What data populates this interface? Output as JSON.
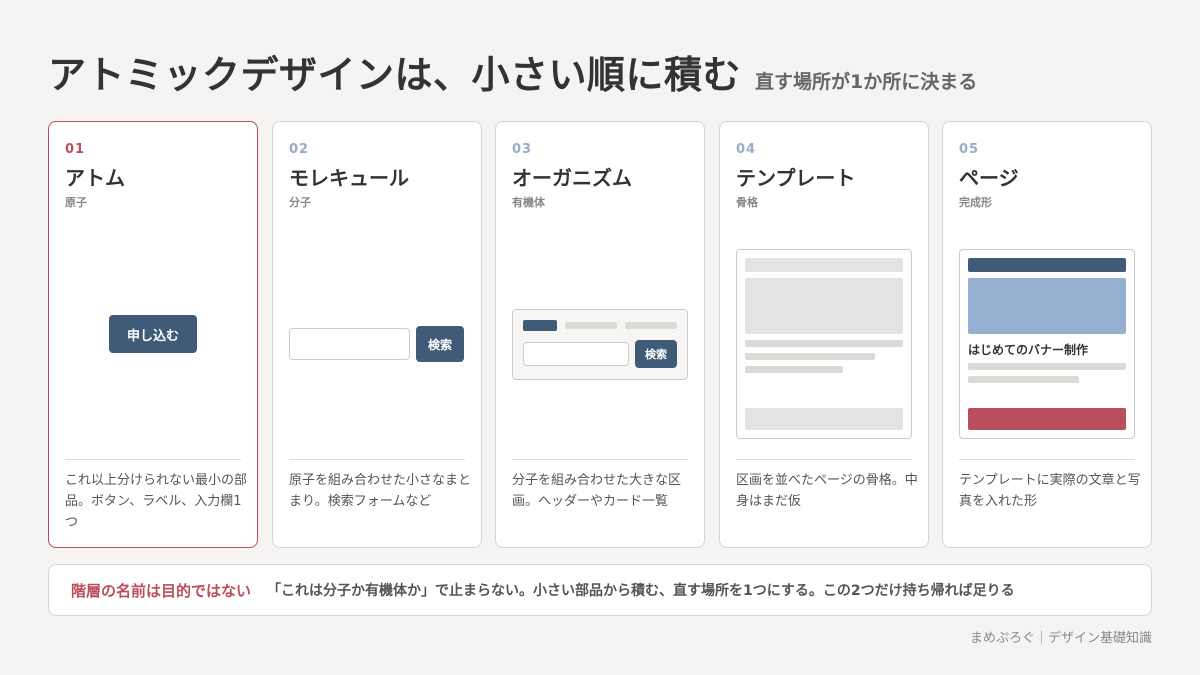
{
  "header": {
    "title": "アトミックデザインは、小さい順に積む",
    "subtitle": "直す場所が1か所に決まる"
  },
  "cards": [
    {
      "num": "01",
      "name": "アトム",
      "sub": "原子",
      "desc": "これ以上分けられない最小の部品。ボタン、ラベル、入力欄1つ",
      "illustration": {
        "button_label": "申し込む"
      }
    },
    {
      "num": "02",
      "name": "モレキュール",
      "sub": "分子",
      "desc": "原子を組み合わせた小さなまとまり。検索フォームなど",
      "illustration": {
        "button_label": "検索"
      }
    },
    {
      "num": "03",
      "name": "オーガニズム",
      "sub": "有機体",
      "desc": "分子を組み合わせた大きな区画。ヘッダーやカード一覧",
      "illustration": {
        "button_label": "検索"
      }
    },
    {
      "num": "04",
      "name": "テンプレート",
      "sub": "骨格",
      "desc": "区画を並べたページの骨格。中身はまだ仮"
    },
    {
      "num": "05",
      "name": "ページ",
      "sub": "完成形",
      "desc": "テンプレートに実際の文章と写真を入れた形",
      "illustration": {
        "page_title": "はじめてのバナー制作"
      }
    }
  ],
  "bottom": {
    "label": "階層の名前は目的ではない",
    "text": "「これは分子か有機体か」で止まらない。小さい部品から積む、直す場所を1つにする。この2つだけ持ち帰れば足りる"
  },
  "footer": "まめぷろぐ｜デザイン基礎知識",
  "colors": {
    "accent": "#b94e5c",
    "navy": "#3f5b77",
    "light_blue": "#96acc8",
    "background": "#f5f4f2"
  }
}
